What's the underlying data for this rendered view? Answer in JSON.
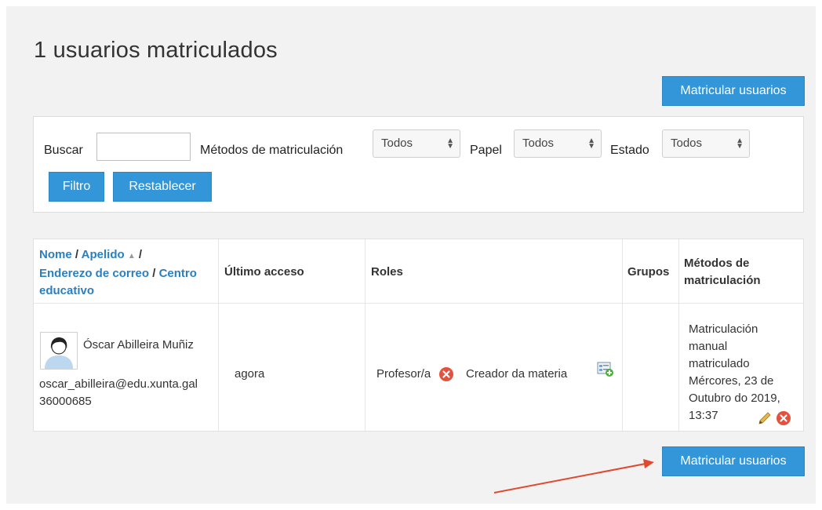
{
  "page": {
    "title": "1 usuarios matriculados"
  },
  "actions": {
    "enrol_label": "Matricular usuarios"
  },
  "filter": {
    "search_label": "Buscar",
    "search_value": "",
    "methods_label": "Métodos de matriculación",
    "methods_value": "Todos",
    "role_label": "Papel",
    "role_value": "Todos",
    "status_label": "Estado",
    "status_value": "Todos",
    "filter_button": "Filtro",
    "reset_button": "Restablecer"
  },
  "table": {
    "headers": {
      "name": "Nome",
      "sep1": " / ",
      "surname": "Apelido",
      "sep2": " /",
      "email": "Enderezo de correo",
      "sep3": " / ",
      "centre1": "Centro",
      "centre2": "educativo",
      "last_access": "Último acceso",
      "roles": "Roles",
      "groups": "Grupos",
      "methods1": "Métodos de",
      "methods2": "matriculación"
    },
    "rows": [
      {
        "name": "Óscar Abilleira Muñiz",
        "email": "oscar_abilleira@edu.xunta.gal",
        "centre": "36000685",
        "last_access": "agora",
        "role1": "Profesor/a",
        "role2": "Creador da materia",
        "method_lines": [
          "Matriculación",
          "manual",
          "matriculado",
          "Mércores, 23 de",
          "Outubro do 2019,",
          "13:37"
        ]
      }
    ]
  },
  "colors": {
    "accent": "#3296d9",
    "link": "#2a7fc1",
    "annotation_arrow": "#e0492f"
  }
}
